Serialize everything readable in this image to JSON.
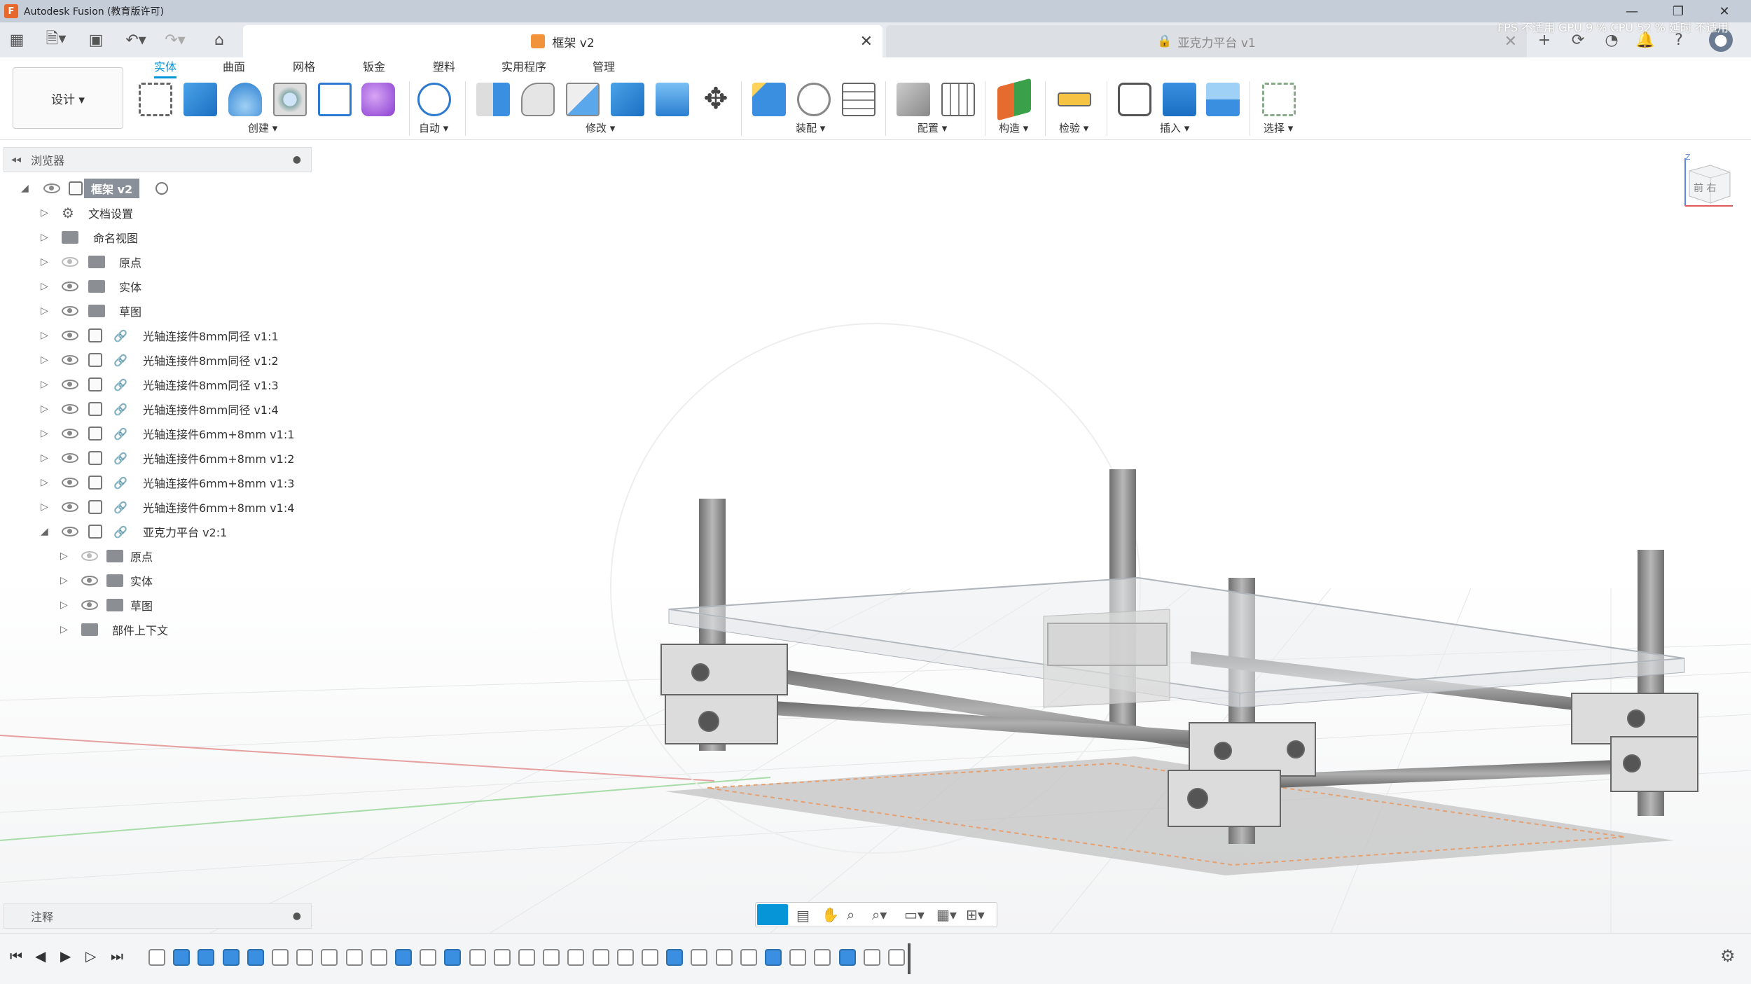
{
  "window": {
    "title": "Autodesk Fusion (教育版许可)",
    "minimize": "—",
    "maximize": "❐",
    "close": "✕"
  },
  "tabs": [
    {
      "label": "框架 v2",
      "close": "✕"
    },
    {
      "label": "亚克力平台 v1",
      "close": "✕"
    }
  ],
  "perf": "FPS 不适用 GPU 9 % CPU 52 % 延时 不适用",
  "workspace": "设计 ▾",
  "ribbon_tabs": [
    "实体",
    "曲面",
    "网格",
    "钣金",
    "塑料",
    "实用程序",
    "管理"
  ],
  "groups": [
    "创建 ▾",
    "自动 ▾",
    "修改 ▾",
    "装配 ▾",
    "配置 ▾",
    "构造 ▾",
    "检验 ▾",
    "插入 ▾",
    "选择 ▾"
  ],
  "browser": {
    "title": "浏览器",
    "toggle": "◂◂",
    "collapse": "●"
  },
  "tree": [
    {
      "label": "框架 v2",
      "depth": 0,
      "tri": "◢",
      "eye": "on",
      "icon": "root"
    },
    {
      "label": "文档设置",
      "depth": 1,
      "tri": "▷",
      "eye": "none",
      "icon": "gear"
    },
    {
      "label": "命名视图",
      "depth": 1,
      "tri": "▷",
      "eye": "none",
      "icon": "folder"
    },
    {
      "label": "原点",
      "depth": 1,
      "tri": "▷",
      "eye": "off",
      "icon": "folder"
    },
    {
      "label": "实体",
      "depth": 1,
      "tri": "▷",
      "eye": "on",
      "icon": "folder"
    },
    {
      "label": "草图",
      "depth": 1,
      "tri": "▷",
      "eye": "on",
      "icon": "folder"
    },
    {
      "label": "光轴连接件8mm同径 v1:1",
      "depth": 1,
      "tri": "▷",
      "eye": "on",
      "icon": "comp-link"
    },
    {
      "label": "光轴连接件8mm同径 v1:2",
      "depth": 1,
      "tri": "▷",
      "eye": "on",
      "icon": "comp-link"
    },
    {
      "label": "光轴连接件8mm同径 v1:3",
      "depth": 1,
      "tri": "▷",
      "eye": "on",
      "icon": "comp-link"
    },
    {
      "label": "光轴连接件8mm同径 v1:4",
      "depth": 1,
      "tri": "▷",
      "eye": "on",
      "icon": "comp-link"
    },
    {
      "label": "光轴连接件6mm+8mm v1:1",
      "depth": 1,
      "tri": "▷",
      "eye": "on",
      "icon": "comp-link"
    },
    {
      "label": "光轴连接件6mm+8mm v1:2",
      "depth": 1,
      "tri": "▷",
      "eye": "on",
      "icon": "comp-link"
    },
    {
      "label": "光轴连接件6mm+8mm v1:3",
      "depth": 1,
      "tri": "▷",
      "eye": "on",
      "icon": "comp-link"
    },
    {
      "label": "光轴连接件6mm+8mm v1:4",
      "depth": 1,
      "tri": "▷",
      "eye": "on",
      "icon": "comp-link"
    },
    {
      "label": "亚克力平台 v2:1",
      "depth": 1,
      "tri": "◢",
      "eye": "on",
      "icon": "comp-link"
    },
    {
      "label": "原点",
      "depth": 2,
      "tri": "▷",
      "eye": "off",
      "icon": "folder"
    },
    {
      "label": "实体",
      "depth": 2,
      "tri": "▷",
      "eye": "on",
      "icon": "folder"
    },
    {
      "label": "草图",
      "depth": 2,
      "tri": "▷",
      "eye": "on",
      "icon": "folder"
    },
    {
      "label": "部件上下文",
      "depth": 2,
      "tri": "▷",
      "eye": "none",
      "icon": "folder"
    }
  ],
  "notes": {
    "title": "注释",
    "toggle": "●"
  },
  "viewcube": {
    "label": "前 右",
    "axis": "Z"
  },
  "colors": {
    "accent": "#0696d7",
    "titlebar": "#c5cdd9",
    "rod": "#8c8c8c",
    "bracket": "#d9d9d9"
  }
}
